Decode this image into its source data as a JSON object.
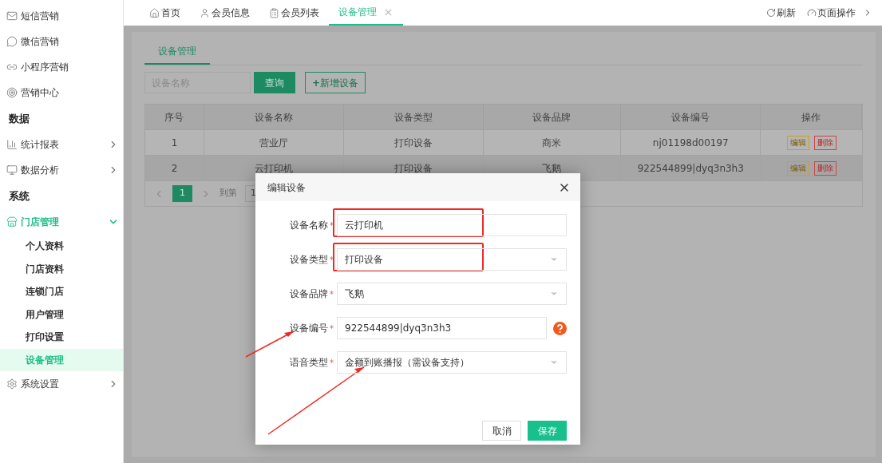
{
  "sidebar": {
    "entries": [
      {
        "kind": "item",
        "label": "短信营销"
      },
      {
        "kind": "item",
        "label": "微信营销"
      },
      {
        "kind": "item",
        "label": "小程序营销"
      },
      {
        "kind": "item",
        "label": "营销中心"
      },
      {
        "kind": "heading",
        "label": "数据"
      },
      {
        "kind": "item",
        "label": "统计报表",
        "expanded": false
      },
      {
        "kind": "item",
        "label": "数据分析",
        "expanded": false
      },
      {
        "kind": "heading",
        "label": "系统"
      },
      {
        "kind": "item",
        "label": "门店管理",
        "expanded": true,
        "children": [
          {
            "label": "个人资料",
            "selected": false
          },
          {
            "label": "门店资料",
            "selected": false
          },
          {
            "label": "连锁门店",
            "selected": false
          },
          {
            "label": "用户管理",
            "selected": false
          },
          {
            "label": "打印设置",
            "selected": false
          },
          {
            "label": "设备管理",
            "selected": true
          }
        ]
      },
      {
        "kind": "item",
        "label": "系统设置",
        "expanded": false
      }
    ]
  },
  "tabs": [
    {
      "label": "首页",
      "selected": false
    },
    {
      "label": "会员信息",
      "selected": false
    },
    {
      "label": "会员列表",
      "selected": false
    },
    {
      "label": "设备管理",
      "selected": true,
      "closable": true
    }
  ],
  "toolbar": {
    "refresh": "刷新",
    "page_actions": "页面操作"
  },
  "page": {
    "tab": "设备管理",
    "search": {
      "placeholder": "设备名称"
    },
    "query_button": "查询",
    "add_button": "**+**新增设备",
    "table": {
      "columns": [
        "序号",
        "设备名称",
        "设备类型",
        "设备品牌",
        "设备编号",
        "操作"
      ],
      "rows": [
        {
          "cells": [
            "1",
            "营业厅",
            "打印设备",
            "商米",
            "nj01198d00197"
          ],
          "selected": false,
          "actions": [
            {
              "kind": "edit",
              "label": "编辑"
            },
            {
              "kind": "delete",
              "label": "删除"
            }
          ]
        },
        {
          "cells": [
            "2",
            "云打印机",
            "打印设备",
            "飞鹅",
            "922544899|dyq3n3h3"
          ],
          "selected": true,
          "actions": [
            {
              "kind": "edit",
              "label": "编辑"
            },
            {
              "kind": "delete",
              "label": "删除"
            }
          ]
        }
      ]
    },
    "pagination": {
      "pages": [
        {
          "label": "1",
          "selected": true
        }
      ],
      "goto_label": "到第",
      "goto_value": "1"
    }
  },
  "dialog": {
    "title": "编辑设备",
    "required_mark": "*",
    "fields": [
      {
        "label": "设备名称",
        "kind": "input",
        "value": "云打印机",
        "required": true,
        "highlighted": true,
        "arrow": false,
        "help": false
      },
      {
        "label": "设备类型",
        "kind": "select",
        "value": "打印设备",
        "required": true,
        "highlighted": true,
        "arrow": false,
        "help": false
      },
      {
        "label": "设备品牌",
        "kind": "select",
        "value": "飞鹅",
        "required": true,
        "highlighted": false,
        "arrow": false,
        "help": false
      },
      {
        "label": "设备编号",
        "kind": "input",
        "value": "922544899|dyq3n3h3",
        "required": true,
        "highlighted": false,
        "arrow": true,
        "help": true
      },
      {
        "label": "语音类型",
        "kind": "select",
        "value": "金额到账播报（需设备支持）",
        "required": true,
        "highlighted": false,
        "arrow": true,
        "help": false
      }
    ],
    "buttons": [
      {
        "kind": "secondary",
        "label": "取消"
      },
      {
        "kind": "primary",
        "label": "保存"
      }
    ]
  }
}
